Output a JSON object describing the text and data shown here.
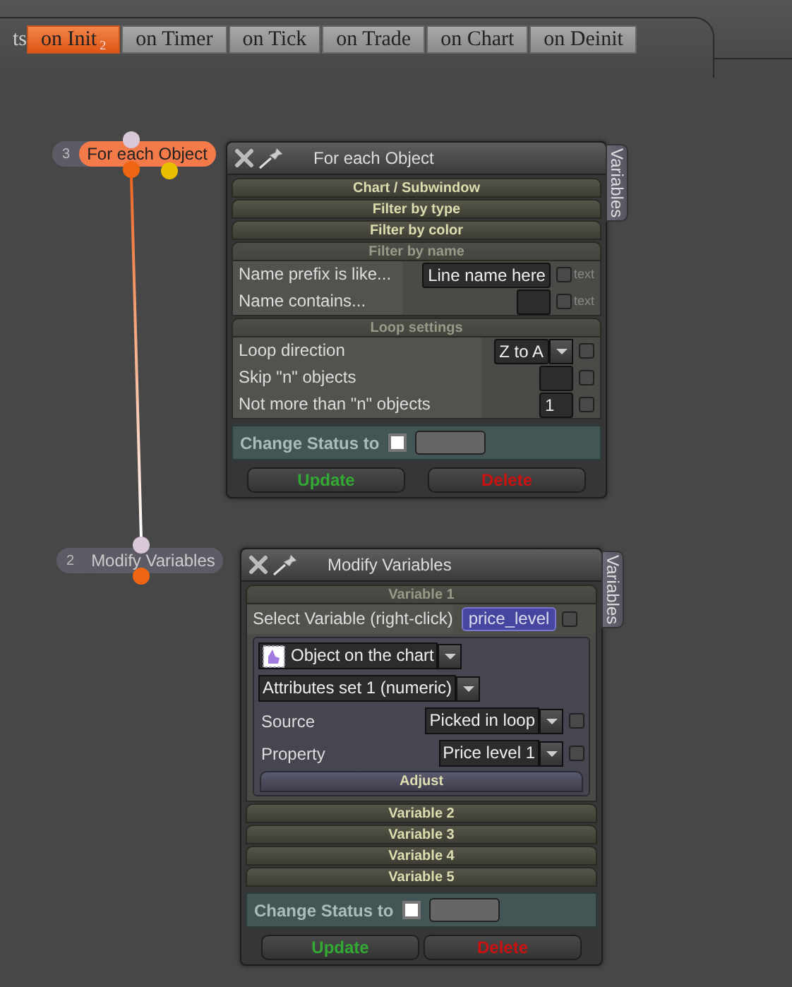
{
  "tab_strip": {
    "cut_label": "ts",
    "tabs": [
      {
        "label": "on Init",
        "count": "2",
        "selected": true
      },
      {
        "label": "on Timer",
        "selected": false
      },
      {
        "label": "on Tick",
        "selected": false
      },
      {
        "label": "on Trade",
        "selected": false
      },
      {
        "label": "on Chart",
        "selected": false
      },
      {
        "label": "on Deinit",
        "selected": false
      }
    ]
  },
  "nodes": [
    {
      "number": "3",
      "label": "For each Object",
      "selected": true
    },
    {
      "number": "2",
      "label": "Modify Variables",
      "selected": false
    }
  ],
  "windows": [
    {
      "kind": "for_each",
      "title": "For each Object",
      "side_tab": "Variables",
      "sections": [
        "Chart / Subwindow",
        "Filter by type",
        "Filter by color"
      ],
      "name_filter": {
        "heading": "Filter by name",
        "rows": [
          {
            "label": "Name prefix is like...",
            "value": "Line name here",
            "checkbox_label": "text",
            "checked": false
          },
          {
            "label": "Name contains...",
            "checkbox_label": "text",
            "checked": false
          }
        ]
      },
      "loop_settings": {
        "heading": "Loop settings",
        "rows": [
          {
            "kind": "select",
            "label": "Loop direction",
            "value": "Z to A",
            "checked": false
          },
          {
            "kind": "input",
            "label": "Skip \"n\" objects",
            "checked": false
          },
          {
            "kind": "input",
            "label": "Not more than \"n\" objects",
            "value": "1",
            "checked": false
          }
        ]
      },
      "status": {
        "label": "Change Status to",
        "checked": false
      },
      "buttons": [
        {
          "kind": "update",
          "label": "Update"
        },
        {
          "kind": "delete",
          "label": "Delete"
        }
      ]
    },
    {
      "kind": "modify_variables",
      "title": "Modify Variables",
      "side_tab": "Variables",
      "variables": [
        {
          "heading": "Variable 1",
          "expanded": true,
          "select_label": "Select Variable (right-click)",
          "variable_name": "price_level",
          "checked": false,
          "object_type": "Object on the chart",
          "attribute_set": "Attributes set 1 (numeric)",
          "rows": [
            {
              "label": "Source",
              "value": "Picked in loop",
              "checked": false
            },
            {
              "label": "Property",
              "value": "Price level 1",
              "checked": false
            }
          ],
          "adjust": "Adjust"
        },
        {
          "heading": "Variable 2",
          "expanded": false
        },
        {
          "heading": "Variable 3",
          "expanded": false
        },
        {
          "heading": "Variable 4",
          "expanded": false
        },
        {
          "heading": "Variable 5",
          "expanded": false
        }
      ],
      "status": {
        "label": "Change Status to",
        "checked": false
      },
      "buttons": [
        {
          "kind": "update",
          "label": "Update"
        },
        {
          "kind": "delete",
          "label": "Delete"
        }
      ]
    }
  ]
}
